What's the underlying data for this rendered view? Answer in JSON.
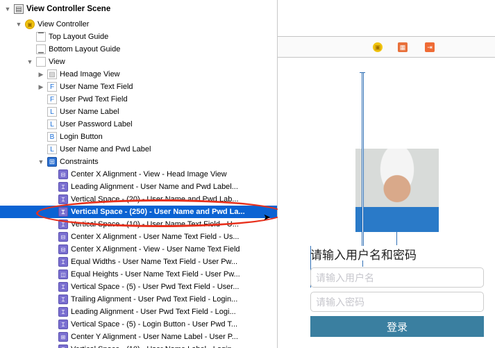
{
  "outline": {
    "scene": "View Controller Scene",
    "view_controller": "View Controller",
    "top_guide": "Top Layout Guide",
    "bottom_guide": "Bottom Layout Guide",
    "view": "View",
    "subviews": [
      {
        "icon": "image",
        "label": "Head Image View"
      },
      {
        "icon": "F",
        "label": "User Name Text Field"
      },
      {
        "icon": "F",
        "label": "User Pwd Text Field"
      },
      {
        "icon": "L",
        "label": "User Name Label"
      },
      {
        "icon": "L",
        "label": "User Password Label"
      },
      {
        "icon": "B",
        "label": "Login Button"
      },
      {
        "icon": "L",
        "label": "User Name and Pwd Label"
      }
    ],
    "constraints_label": "Constraints",
    "constraints": [
      "Center X Alignment - View - Head Image View",
      "Leading Alignment - User Name and Pwd Label...",
      "Vertical Space - (20) - User Name and Pwd Lab...",
      "Vertical Space - (250) - User Name and Pwd La...",
      "Vertical Space - (10) - User Name Text Field - U...",
      "Center X Alignment - User Name Text Field - Us...",
      "Center X Alignment - View - User Name Text Field",
      "Equal Widths - User Name Text Field - User Pw...",
      "Equal Heights - User Name Text Field - User Pw...",
      "Vertical Space - (5) - User Pwd Text Field - User...",
      "Trailing Alignment - User Pwd Text Field - Login...",
      "Leading Alignment - User Pwd Text Field - Logi...",
      "Vertical Space - (5) - Login Button - User Pwd T...",
      "Center Y Alignment - User Name Label - User P...",
      "Vertical Space - (10) - User Name Label - Login..."
    ],
    "selected_index": 3
  },
  "canvas": {
    "prompt_label": "请输入用户名和密码",
    "username_placeholder": "请输入用户名",
    "password_placeholder": "请输入密码",
    "login_button": "登录"
  },
  "colors": {
    "selection": "#0b63d3",
    "login_button": "#3a7fa0",
    "annotation": "#e8301c"
  }
}
